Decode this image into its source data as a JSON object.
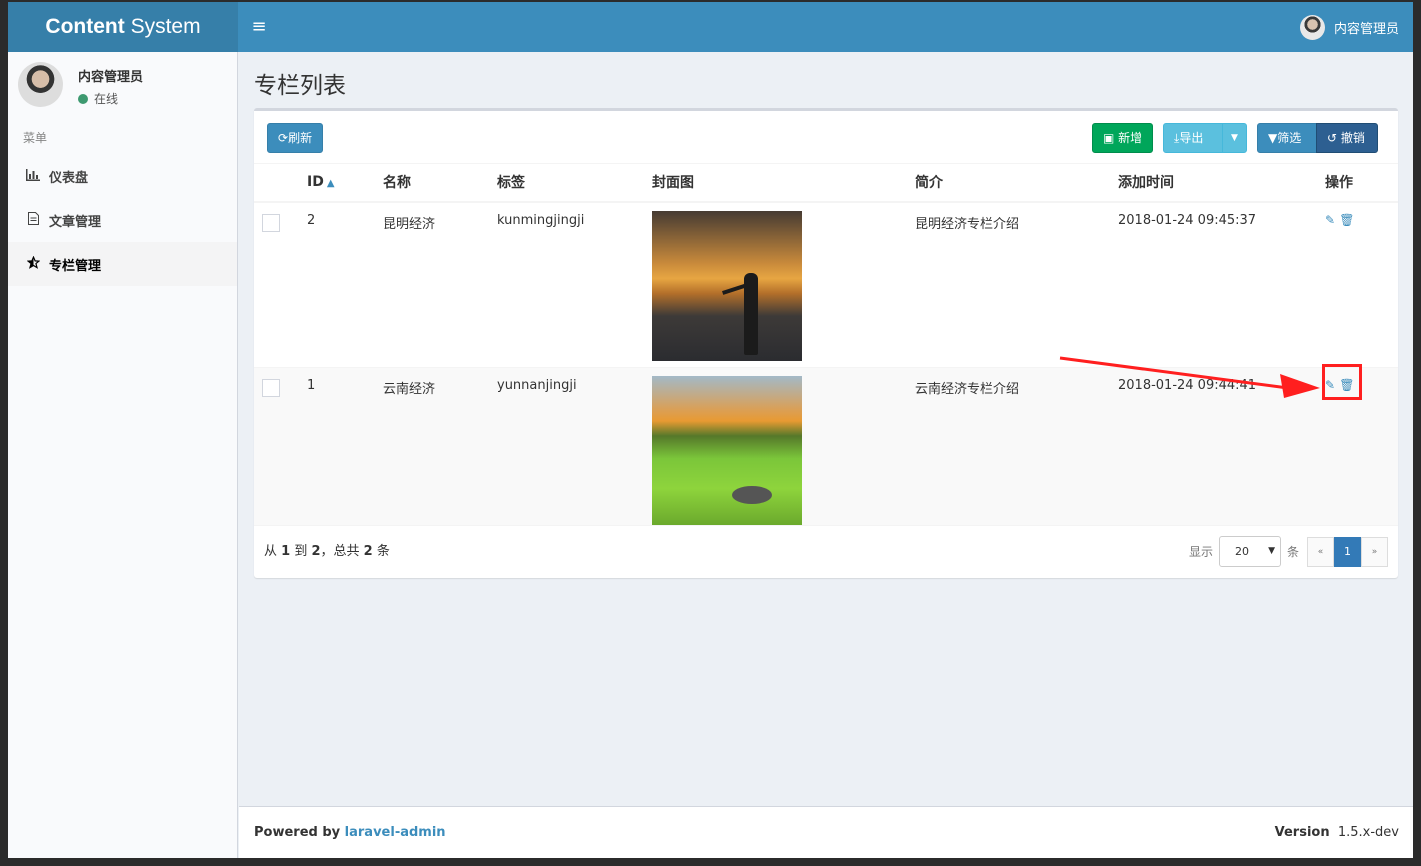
{
  "header": {
    "logo_bold": "Content",
    "logo_rest": " System",
    "toggle_glyph": "≡",
    "user_name": "内容管理员"
  },
  "sidebar": {
    "user_name": "内容管理员",
    "status": "在线",
    "menu_header": "菜单",
    "items": [
      {
        "label": "仪表盘",
        "icon": "bar-chart-icon",
        "glyph": "📊",
        "active": false
      },
      {
        "label": "文章管理",
        "icon": "file-icon",
        "glyph": "▤",
        "active": false
      },
      {
        "label": "专栏管理",
        "icon": "star-icon",
        "glyph": "★",
        "active": true
      }
    ]
  },
  "page": {
    "title": "专栏列表"
  },
  "toolbar": {
    "refresh": "刷新",
    "new": "新增",
    "export": "导出",
    "filter": "筛选",
    "reset": "撤销"
  },
  "table": {
    "columns": [
      "ID",
      "名称",
      "标签",
      "封面图",
      "简介",
      "添加时间",
      "操作"
    ],
    "rows": [
      {
        "id": "2",
        "name": "昆明经济",
        "tag": "kunmingjingji",
        "cover": "sunset-beach-image",
        "intro": "昆明经济专栏介绍",
        "created_at": "2018-01-24 09:45:37"
      },
      {
        "id": "1",
        "name": "云南经济",
        "tag": "yunnanjingji",
        "cover": "green-valley-image",
        "intro": "云南经济专栏介绍",
        "created_at": "2018-01-24 09:44:41"
      }
    ]
  },
  "pagination": {
    "summary_prefix": "从 ",
    "from": "1",
    "to_word": " 到 ",
    "to": "2",
    "total_word": "，总共 ",
    "total": "2",
    "unit": " 条",
    "show_label": "显示",
    "per_page": "20",
    "per_page_unit": "条",
    "prev": "«",
    "current": "1",
    "next": "»"
  },
  "footer": {
    "powered_by": "Powered by ",
    "link": "laravel-admin",
    "version_label": "Version",
    "version": "1.5.x-dev"
  },
  "colors": {
    "header": "#3c8dbc",
    "logo_bg": "#367fa9",
    "success": "#00a65a",
    "info": "#5bc0de",
    "annotation": "#ff1f1f"
  }
}
